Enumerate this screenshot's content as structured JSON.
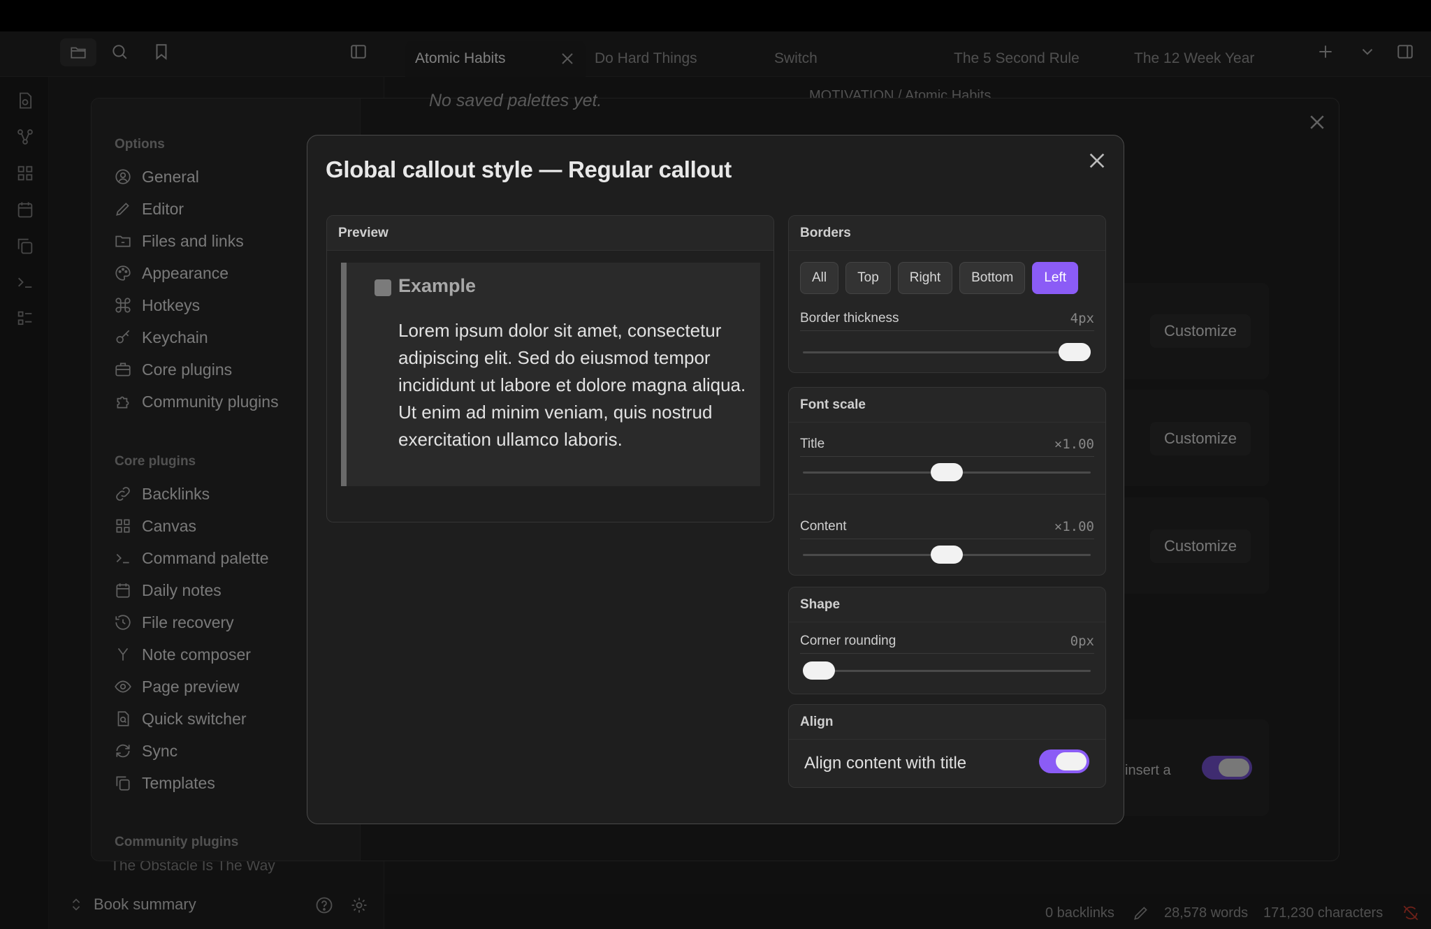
{
  "tabs": [
    {
      "label": "Atomic Habits",
      "active": true
    },
    {
      "label": "Do Hard Things"
    },
    {
      "label": "Switch"
    },
    {
      "label": "The 5 Second Rule"
    },
    {
      "label": "The 12 Week Year"
    }
  ],
  "editor": {
    "breadcrumb": "MOTIVATION / Atomic Habits",
    "no_palettes_text": "No saved palettes yet.",
    "partial_text": "insert a"
  },
  "left_pane": {
    "vault_item": "The Obstacle Is The Way",
    "vault_name": "Book summary"
  },
  "settings": {
    "options_heading": "Options",
    "options": [
      {
        "label": "General",
        "icon": "person-circle-icon"
      },
      {
        "label": "Editor",
        "icon": "pencil-icon"
      },
      {
        "label": "Files and links",
        "icon": "folder-link-icon"
      },
      {
        "label": "Appearance",
        "icon": "palette-icon"
      },
      {
        "label": "Hotkeys",
        "icon": "command-icon"
      },
      {
        "label": "Keychain",
        "icon": "key-icon"
      },
      {
        "label": "Core plugins",
        "icon": "briefcase-icon"
      },
      {
        "label": "Community plugins",
        "icon": "puzzle-icon"
      }
    ],
    "core_heading": "Core plugins",
    "core_plugins": [
      {
        "label": "Backlinks",
        "icon": "link-icon"
      },
      {
        "label": "Canvas",
        "icon": "grid-icon"
      },
      {
        "label": "Command palette",
        "icon": "terminal-icon"
      },
      {
        "label": "Daily notes",
        "icon": "calendar-icon"
      },
      {
        "label": "File recovery",
        "icon": "history-icon"
      },
      {
        "label": "Note composer",
        "icon": "merge-icon"
      },
      {
        "label": "Page preview",
        "icon": "eye-icon"
      },
      {
        "label": "Quick switcher",
        "icon": "file-search-icon"
      },
      {
        "label": "Sync",
        "icon": "sync-icon"
      },
      {
        "label": "Templates",
        "icon": "copy-icon"
      }
    ],
    "community_heading": "Community plugins",
    "customize_label": "Customize"
  },
  "modal": {
    "title": "Global callout style — Regular callout",
    "preview": {
      "header": "Preview",
      "callout_title": "Example",
      "callout_body": "Lorem ipsum dolor sit amet, consectetur adipiscing elit. Sed do eiusmod tempor incididunt ut labore et dolore magna aliqua. Ut enim ad minim veniam, quis nostrud exercitation ullamco laboris."
    },
    "borders": {
      "header": "Borders",
      "buttons": [
        "All",
        "Top",
        "Right",
        "Bottom",
        "Left"
      ],
      "selected": "Left",
      "thickness_label": "Border thickness",
      "thickness_value": "4px",
      "thickness_level": 1.0
    },
    "font_scale": {
      "header": "Font scale",
      "title_label": "Title",
      "title_value": "×1.00",
      "title_level": 0.5,
      "content_label": "Content",
      "content_value": "×1.00",
      "content_level": 0.5
    },
    "shape": {
      "header": "Shape",
      "rounding_label": "Corner rounding",
      "rounding_value": "0px",
      "rounding_level": 0.0
    },
    "align": {
      "header": "Align",
      "toggle_label": "Align content with title",
      "toggle_on": true
    }
  },
  "status_bar": {
    "backlinks": "0 backlinks",
    "words": "28,578 words",
    "characters": "171,230 characters"
  },
  "colors": {
    "accent": "#8b5cf6",
    "background": "#1e1e1e"
  }
}
